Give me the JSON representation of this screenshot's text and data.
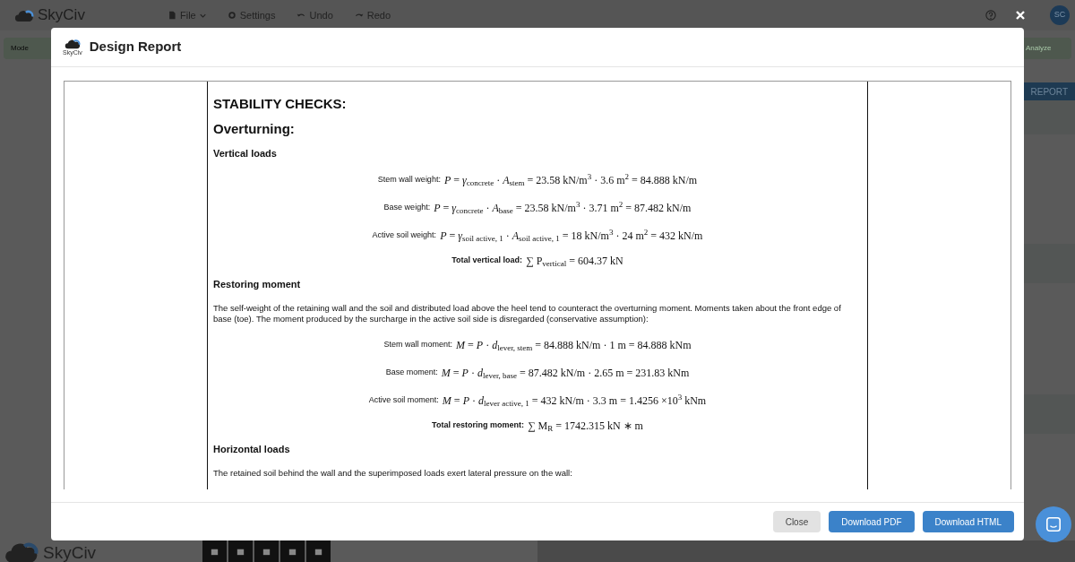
{
  "app_bar": {
    "logo": "SkyCiv",
    "menu": [
      {
        "label": "File",
        "kind": "dropdown"
      },
      {
        "label": "Settings",
        "kind": "gear"
      },
      {
        "label": "Undo",
        "kind": "undo"
      },
      {
        "label": "Redo",
        "kind": "redo"
      }
    ],
    "avatar": "SC"
  },
  "background": {
    "left_button": "Mode",
    "right_button": "Analyze",
    "report_button": "REPORT",
    "footer_logo": "SkyCiv"
  },
  "modal": {
    "title": "Design Report",
    "logo_caption": "SkyCiv",
    "report": [
      {
        "kind": "h1",
        "text": "STABILITY CHECKS:"
      },
      {
        "kind": "h2",
        "text": "Overturning:"
      },
      {
        "kind": "h3",
        "text": "Vertical loads"
      },
      {
        "kind": "eq",
        "label": "Stem wall weight:",
        "formula": "*P* = *γ*$_{concrete}$ · *A*$_{stem}$ = 23.58 kN/m$^{3}$ · 3.6 m$^{2}$ = 84.888 kN/m"
      },
      {
        "kind": "eq",
        "label": "Base weight:",
        "formula": "*P* = *γ*$_{concrete}$ · *A*$_{base}$ = 23.58 kN/m$^{3}$ · 3.71 m$^{2}$ = 87.482 kN/m"
      },
      {
        "kind": "eq",
        "label": "Active soil weight:",
        "formula": "*P* = *γ*$_{soil active, 1}$ · *A*$_{soil active, 1}$ = 18 kN/m$^{3}$ · 24 m$^{2}$ = 432 kN/m"
      },
      {
        "kind": "total",
        "label": "Total vertical load:",
        "formula": "∑ P$_{vertical}$ = 604.37 kN"
      },
      {
        "kind": "h3",
        "text": "Restoring moment"
      },
      {
        "kind": "p",
        "text": "The self-weight of the retaining wall and the soil and distributed load above the heel tend to counteract the overturning moment. Moments taken about the front edge of base (toe). The moment produced by the surcharge in the active soil side is disregarded (conservative assumption):"
      },
      {
        "kind": "eq",
        "label": "Stem wall moment:",
        "formula": "*M* = *P* · *d*$_{lever, stem}$ = 84.888 kN/m · 1 m = 84.888 kNm"
      },
      {
        "kind": "eq",
        "label": "Base moment:",
        "formula": "*M* = *P* · *d*$_{lever, base}$ = 87.482 kN/m · 2.65 m = 231.83 kNm"
      },
      {
        "kind": "eq",
        "label": "Active soil moment:",
        "formula": "*M* = *P* · *d*$_{lever active, 1}$ = 432 kN/m · 3.3 m = 1.4256 ×10$^{3}$ kNm"
      },
      {
        "kind": "total",
        "label": "Total restoring moment:",
        "formula": "∑ M$_{R}$ = 1742.315 kN ∗ m"
      },
      {
        "kind": "h3",
        "text": "Horizontal loads"
      },
      {
        "kind": "p",
        "text": "The retained soil behind the wall and the superimposed loads exert lateral pressure on the wall:"
      }
    ],
    "buttons": [
      {
        "label": "Close",
        "kind": "secondary"
      },
      {
        "label": "Download PDF",
        "kind": "primary"
      },
      {
        "label": "Download HTML",
        "kind": "primary"
      }
    ]
  }
}
